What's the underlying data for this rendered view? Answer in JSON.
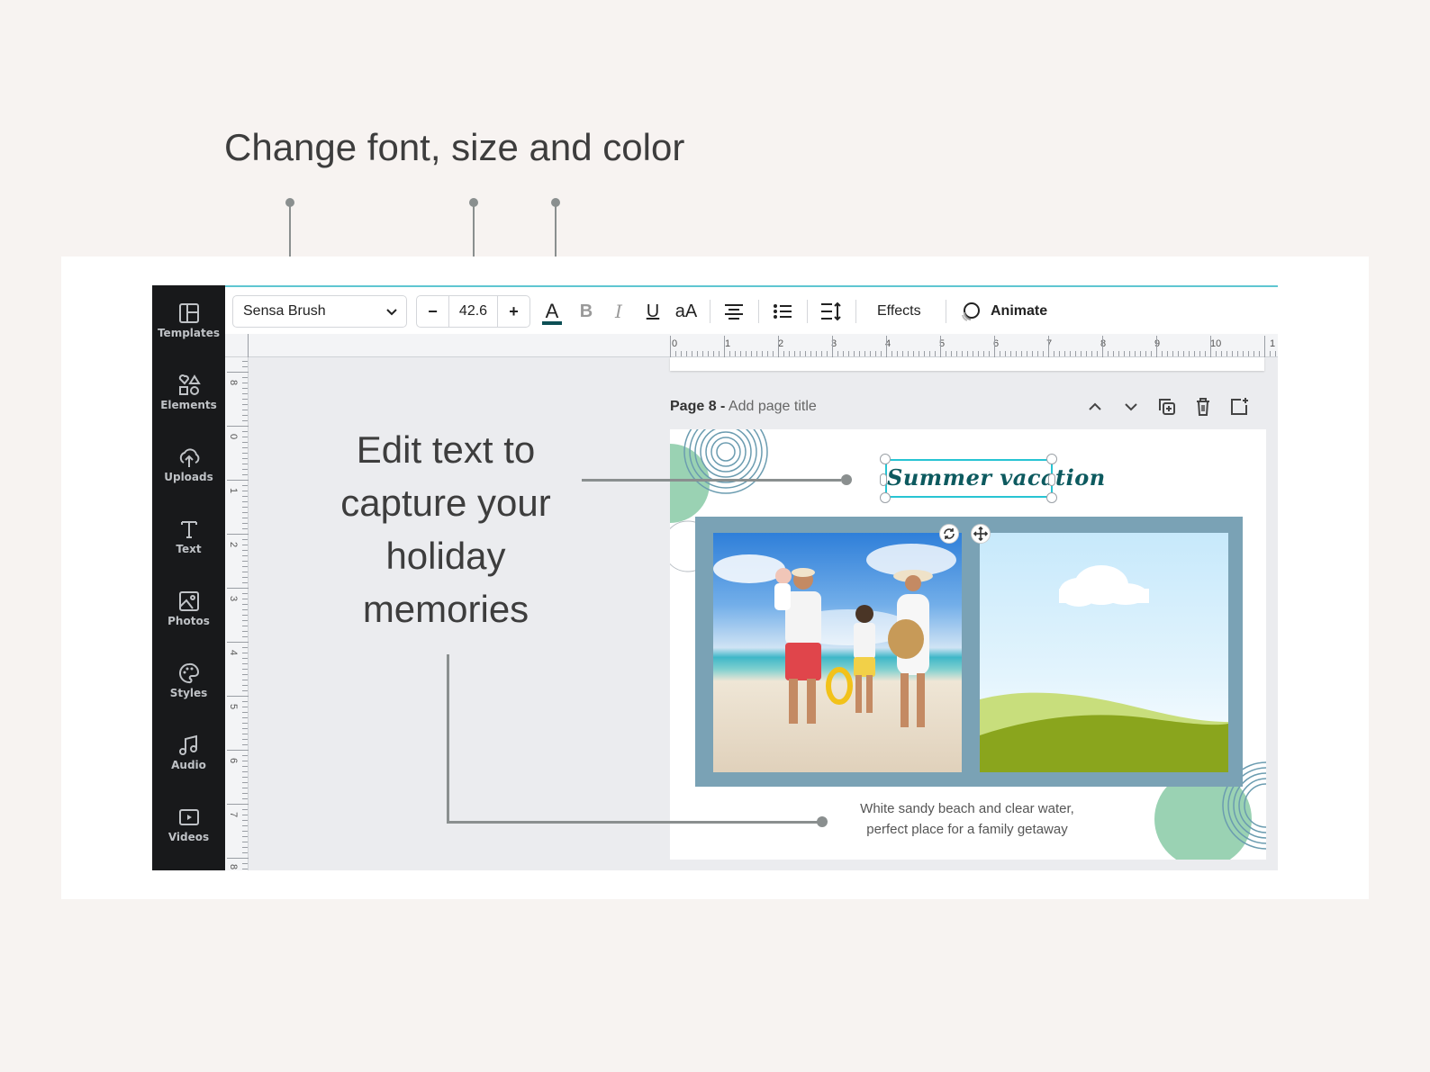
{
  "headline": "Change font, size and color",
  "edit_callout": "Edit text to capture your holiday memories",
  "sidebar": {
    "items": [
      {
        "label": "Templates",
        "icon": "templates-icon"
      },
      {
        "label": "Elements",
        "icon": "elements-icon"
      },
      {
        "label": "Uploads",
        "icon": "upload-icon"
      },
      {
        "label": "Text",
        "icon": "text-icon"
      },
      {
        "label": "Photos",
        "icon": "photos-icon"
      },
      {
        "label": "Styles",
        "icon": "palette-icon"
      },
      {
        "label": "Audio",
        "icon": "music-icon"
      },
      {
        "label": "Videos",
        "icon": "video-icon"
      }
    ]
  },
  "toolbar": {
    "font_name": "Sensa Brush",
    "font_size": "42.6",
    "minus_label": "−",
    "plus_label": "+",
    "text_color_glyph": "A",
    "bold_glyph": "B",
    "italic_glyph": "I",
    "underline_glyph": "U",
    "case_glyph": "aA",
    "effects_label": "Effects",
    "animate_label": "Animate",
    "text_color": "#0d4f55"
  },
  "ruler": {
    "top_numbers": [
      "0",
      "1",
      "2",
      "3",
      "4",
      "5",
      "6",
      "7",
      "8",
      "9",
      "10",
      "1"
    ],
    "left_numbers": [
      "8",
      "0",
      "1",
      "2",
      "3",
      "4",
      "5",
      "6",
      "7",
      "8"
    ]
  },
  "page": {
    "number_label": "Page 8 -",
    "title_placeholder": "Add page title",
    "title_text": "Summer vacation",
    "caption_line1": "White sandy beach and clear water,",
    "caption_line2": "perfect place for a family getaway"
  },
  "colors": {
    "accent": "#27c4d3",
    "sidebar": "#18191b",
    "photo_frame": "#7aa2b5",
    "canvas": "#ebecef",
    "background": "#f7f3f1"
  }
}
